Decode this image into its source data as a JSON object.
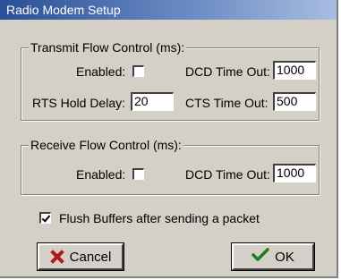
{
  "window": {
    "title": "Radio Modem Setup"
  },
  "transmit": {
    "legend": "Transmit Flow Control (ms):",
    "enabled_label": "Enabled:",
    "enabled_checked": false,
    "dcd_label": "DCD Time Out:",
    "dcd_value": "1000",
    "rts_label": "RTS Hold Delay:",
    "rts_value": "20",
    "cts_label": "CTS Time Out:",
    "cts_value": "500"
  },
  "receive": {
    "legend": "Receive Flow Control (ms):",
    "enabled_label": "Enabled:",
    "enabled_checked": false,
    "dcd_label": "DCD Time Out:",
    "dcd_value": "1000"
  },
  "flush": {
    "label": "Flush Buffers after sending a packet",
    "checked": true
  },
  "buttons": {
    "cancel_label": "Cancel",
    "ok_label": "OK"
  },
  "icons": {
    "cancel": "x-icon",
    "ok": "checkmark-icon"
  }
}
